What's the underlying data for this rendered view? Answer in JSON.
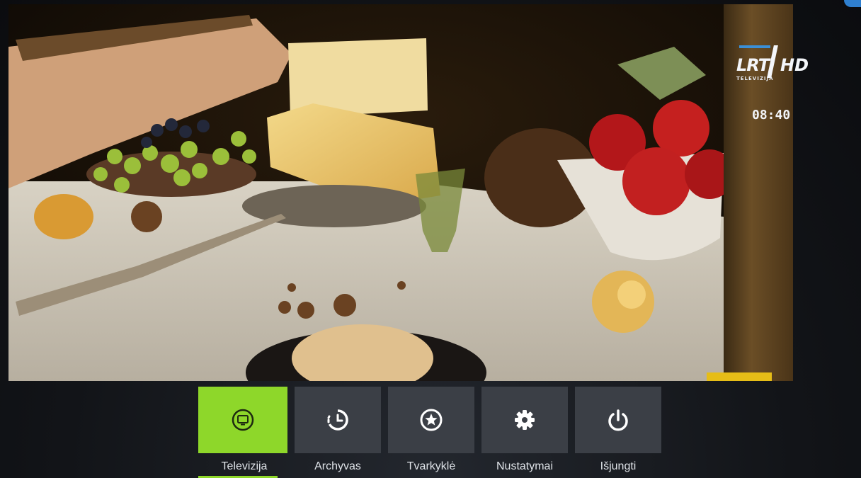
{
  "channel": {
    "logo_main": "LRT",
    "logo_hd": "HD",
    "logo_sub": "TELEVIZIJA"
  },
  "clock": "08:40",
  "colors": {
    "active_tile": "#8ed72a",
    "tile": "#3b3f46",
    "progress": "#e6bd17"
  },
  "playback_progress": 0.92,
  "menu": [
    {
      "label": "Televizija",
      "icon": "tv-icon",
      "active": true
    },
    {
      "label": "Archyvas",
      "icon": "history-icon",
      "active": false
    },
    {
      "label": "Tvarkyklė",
      "icon": "star-icon",
      "active": false
    },
    {
      "label": "Nustatymai",
      "icon": "gear-icon",
      "active": false
    },
    {
      "label": "Išjungti",
      "icon": "power-icon",
      "active": false
    }
  ]
}
